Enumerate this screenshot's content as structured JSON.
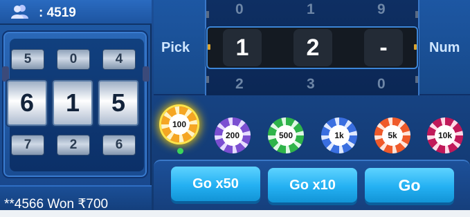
{
  "header": {
    "online_count": ": 4519",
    "users_icon": "users-icon"
  },
  "slot": {
    "top_row": [
      "5",
      "0",
      "4"
    ],
    "middle_row": [
      "6",
      "1",
      "5"
    ],
    "bottom_row": [
      "7",
      "2",
      "6"
    ]
  },
  "ticker": {
    "text": "**4566 Won ₹700"
  },
  "pick": {
    "left_label": "Pick",
    "right_label": "Num",
    "above_row": [
      "0",
      "1",
      "9"
    ],
    "current": [
      "1",
      "2",
      "-"
    ],
    "below_row": [
      "2",
      "3",
      "0"
    ]
  },
  "chips": [
    {
      "label": "100",
      "color": "#f5a623",
      "selected": true
    },
    {
      "label": "200",
      "color": "#7b4fd1",
      "selected": false
    },
    {
      "label": "500",
      "color": "#2fb34a",
      "selected": false
    },
    {
      "label": "1k",
      "color": "#3a6fe0",
      "selected": false
    },
    {
      "label": "5k",
      "color": "#ef5a2a",
      "selected": false
    },
    {
      "label": "10k",
      "color": "#c0195a",
      "selected": false
    }
  ],
  "actions": {
    "go50": "Go x50",
    "go10": "Go x10",
    "go": "Go"
  },
  "colors": {
    "accent": "#24b0f2",
    "panel": "#1c4f97",
    "selected_glow": "#ffd200"
  }
}
